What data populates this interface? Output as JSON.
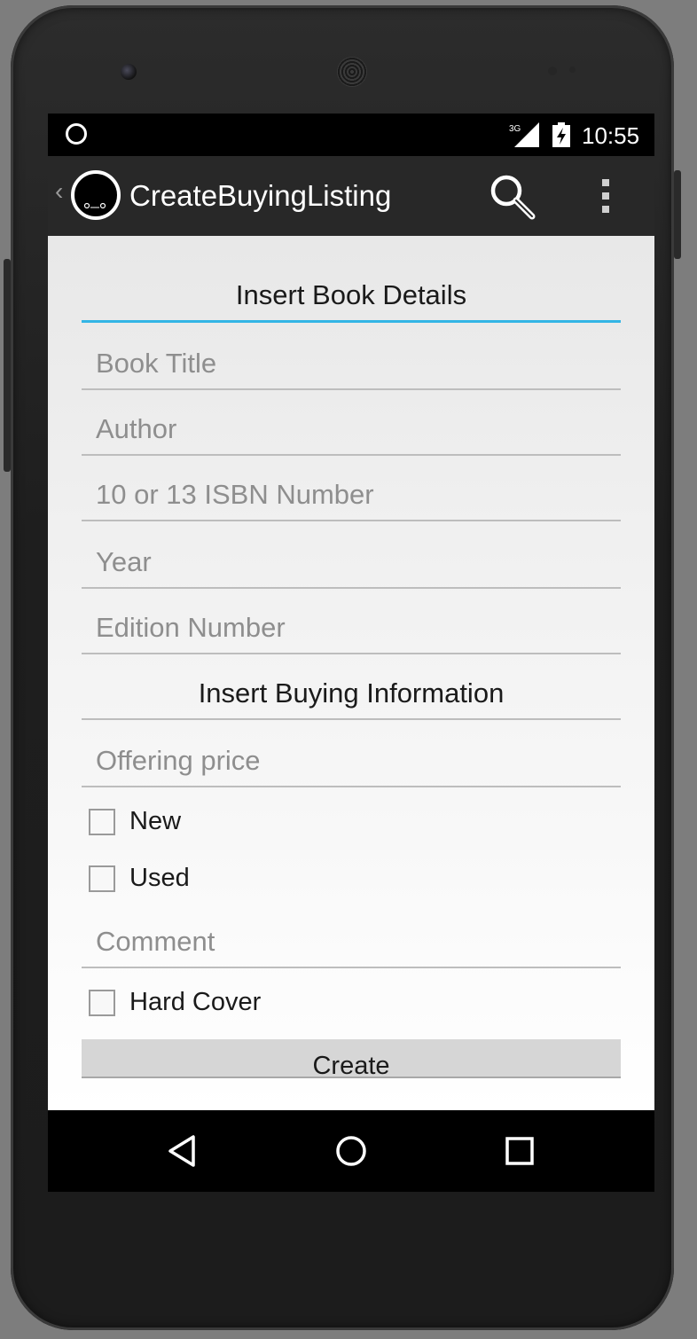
{
  "status_bar": {
    "network": "3G",
    "time": "10:55"
  },
  "action_bar": {
    "title": "CreateBuyingListing",
    "icons": [
      "back-chevron-icon",
      "app-icon",
      "search-icon",
      "overflow-menu-icon"
    ]
  },
  "form": {
    "book_section_heading": "Insert Book Details",
    "book_title_placeholder": "Book Title",
    "author_placeholder": "Author",
    "isbn_placeholder": "10 or 13 ISBN Number",
    "year_placeholder": "Year",
    "edition_placeholder": "Edition Number",
    "buying_section_heading": "Insert Buying Information",
    "price_placeholder": "Offering price",
    "new_label": "New",
    "new_checked": false,
    "used_label": "Used",
    "used_checked": false,
    "comment_placeholder": "Comment",
    "hard_cover_label": "Hard Cover",
    "hard_cover_checked": false,
    "create_button": "Create"
  },
  "nav_bar": {
    "icons": [
      "back-triangle-icon",
      "home-circle-icon",
      "recents-square-icon"
    ]
  },
  "colors": {
    "accent": "#33b5e5",
    "action_bar": "#282828",
    "button": "#d6d6d6"
  }
}
